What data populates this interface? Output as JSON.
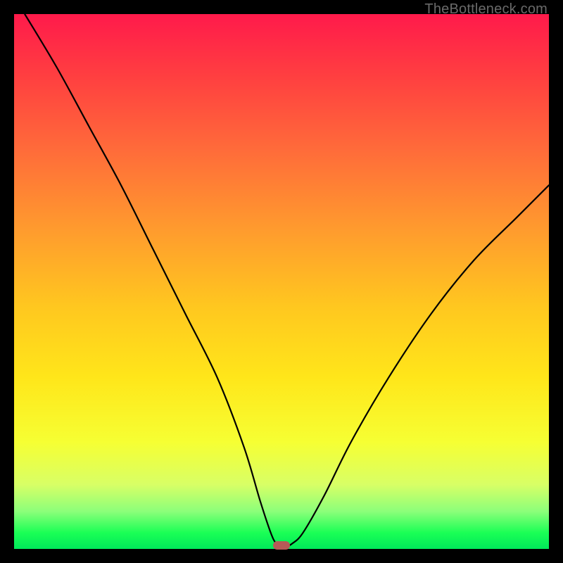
{
  "watermark": "TheBottleneck.com",
  "chart_data": {
    "type": "line",
    "title": "",
    "xlabel": "",
    "ylabel": "",
    "xlim": [
      0,
      100
    ],
    "ylim": [
      0,
      100
    ],
    "series": [
      {
        "name": "bottleneck-curve",
        "x": [
          2,
          8,
          14,
          20,
          26,
          32,
          38,
          43,
          46,
          48,
          49,
          50,
          51,
          52,
          54,
          58,
          63,
          70,
          78,
          86,
          94,
          100
        ],
        "values": [
          100,
          90,
          79,
          68,
          56,
          44,
          32,
          19,
          9,
          3,
          1,
          0.5,
          0.5,
          1,
          3,
          10,
          20,
          32,
          44,
          54,
          62,
          68
        ]
      }
    ],
    "marker": {
      "x": 50,
      "y": 0.6,
      "color": "#b65a57"
    },
    "gradient_stops": [
      {
        "pos": 0,
        "color": "#ff1a4b"
      },
      {
        "pos": 25,
        "color": "#ff6a3a"
      },
      {
        "pos": 55,
        "color": "#ffc81f"
      },
      {
        "pos": 80,
        "color": "#f6ff33"
      },
      {
        "pos": 100,
        "color": "#00e85a"
      }
    ]
  }
}
